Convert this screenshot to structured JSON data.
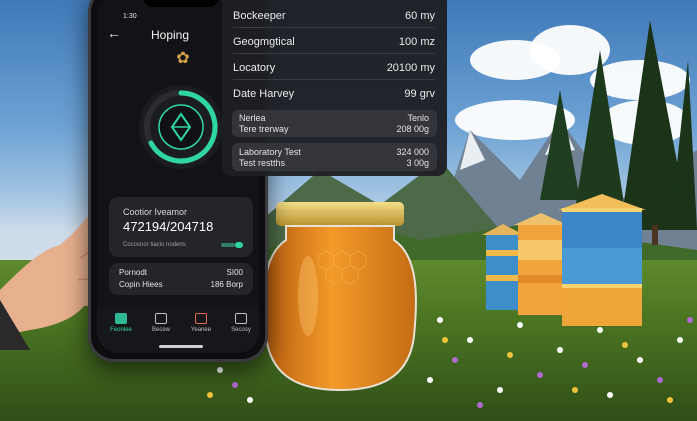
{
  "phone": {
    "status_time": "1:30",
    "title": "Hoping",
    "card1": {
      "label": "Cootior Iveamor",
      "value": "472194/204718",
      "sub": "Cocosnor tiacio nodens"
    },
    "card2": {
      "rows": [
        {
          "key": "Pornodt",
          "value": "SI00"
        },
        {
          "key": "Copin Hiees",
          "value": "186 Borp"
        }
      ]
    },
    "nav": [
      {
        "label": "Feonlee",
        "icon": "hive-icon",
        "active": true
      },
      {
        "label": "Becew",
        "icon": "add-icon",
        "active": false
      },
      {
        "label": "Yeanee",
        "icon": "bee-icon",
        "active": false
      },
      {
        "label": "Secosy",
        "icon": "trash-icon",
        "active": false
      }
    ]
  },
  "panel": {
    "rows": [
      {
        "key": "Bockeeper",
        "value": "60 my"
      },
      {
        "key": "Geogmgtical",
        "value": "100 mz"
      },
      {
        "key": "Locatory",
        "value": "20100 my"
      },
      {
        "key": "Date Harvey",
        "value": "99 grv"
      }
    ],
    "box1": [
      {
        "key": "Nerlea",
        "value": "Tenlo"
      },
      {
        "key": "Tere trerway",
        "value": "208 00g"
      }
    ],
    "box2": [
      {
        "key": "Laboratory Test",
        "value": "324 000"
      },
      {
        "key": "Test restths",
        "value": "3 00g"
      }
    ]
  },
  "colors": {
    "accent": "#2fd6a0",
    "honey": "#e58a1c",
    "panel_bg": "#1e1f23"
  }
}
